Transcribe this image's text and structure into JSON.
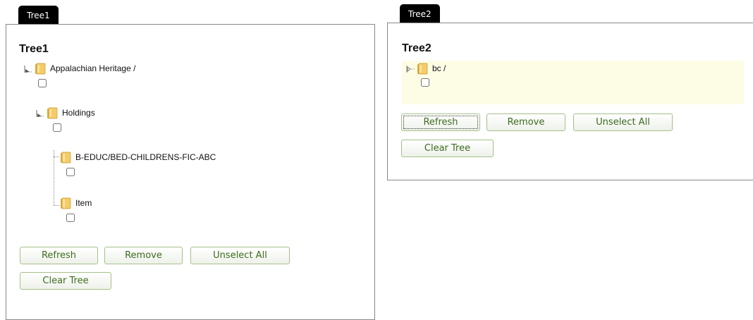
{
  "tree1": {
    "tab_label": "Tree1",
    "title": "Tree1",
    "nodes": [
      {
        "label": "Appalachian Heritage /"
      },
      {
        "label": "Holdings"
      },
      {
        "label": "B-EDUC/BED-CHILDRENS-FIC-ABC"
      },
      {
        "label": "Item"
      }
    ],
    "buttons": {
      "refresh": "Refresh",
      "remove": "Remove",
      "unselect_all": "Unselect All",
      "clear_tree": "Clear Tree"
    }
  },
  "tree2": {
    "tab_label": "Tree2",
    "title": "Tree2",
    "nodes": [
      {
        "label": "bc /"
      }
    ],
    "highlight_color": "#fdfde6",
    "buttons": {
      "refresh": "Refresh",
      "remove": "Remove",
      "unselect_all": "Unselect All",
      "clear_tree": "Clear Tree"
    }
  },
  "colors": {
    "button_text": "#3d6b1f",
    "button_border": "#a5c08a",
    "tab_background": "#000000",
    "folder": "#e8b84a"
  }
}
